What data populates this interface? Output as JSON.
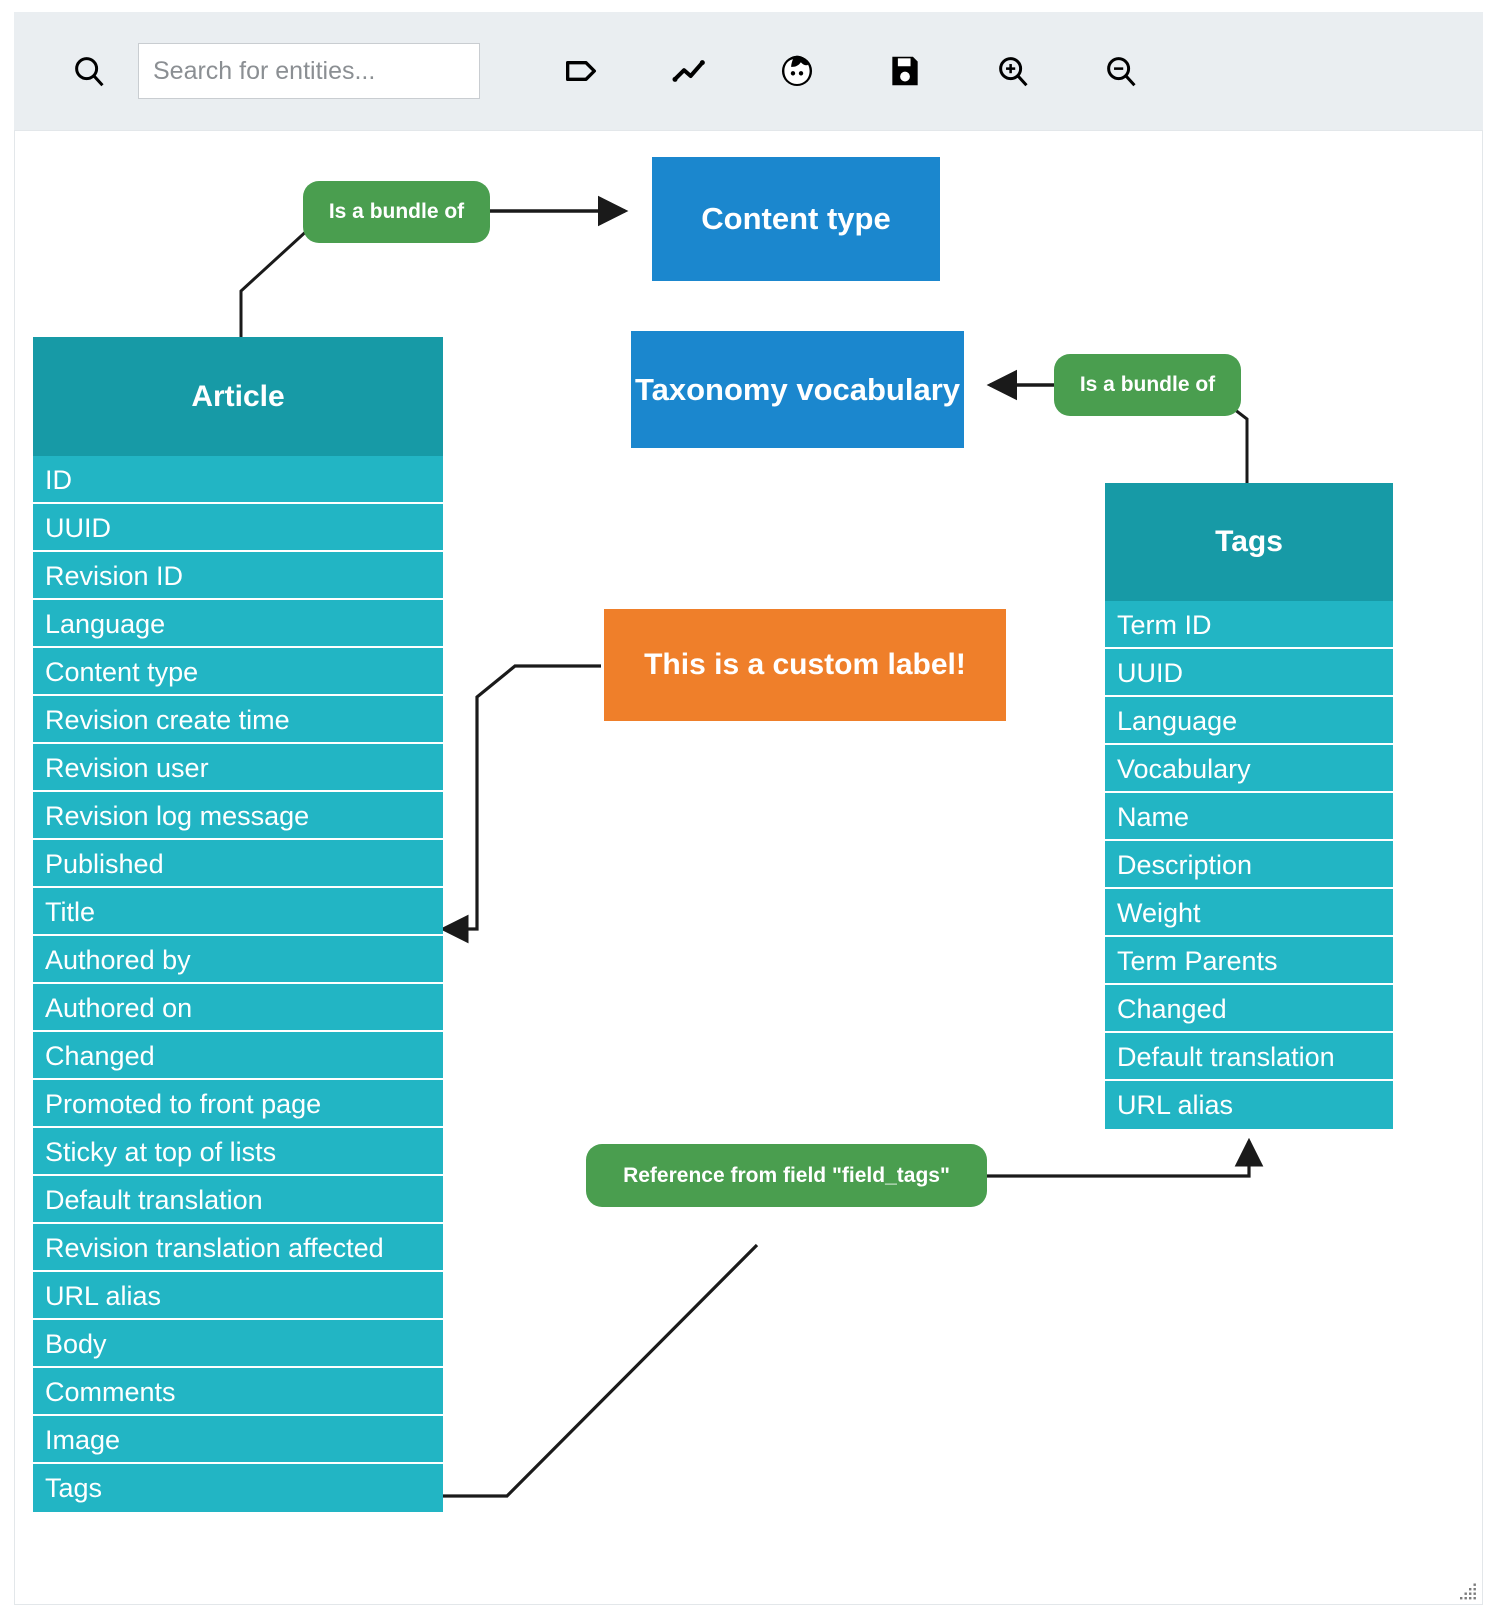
{
  "toolbar": {
    "search_icon": "search-icon",
    "search": {
      "value": "",
      "placeholder": "Search for entities..."
    },
    "buttons": [
      {
        "name": "tag-icon",
        "label": "Tag"
      },
      {
        "name": "line-chart-icon",
        "label": "Relations"
      },
      {
        "name": "person-icon",
        "label": "User"
      },
      {
        "name": "save-icon",
        "label": "Save"
      },
      {
        "name": "zoom-in-icon",
        "label": "Zoom in"
      },
      {
        "name": "zoom-out-icon",
        "label": "Zoom out"
      }
    ]
  },
  "colors": {
    "toolbar_bg": "#eaeef1",
    "entity_header": "#179aa6",
    "entity_row": "#22b5c4",
    "box_blue": "#1b87ce",
    "box_orange": "#ef7f2a",
    "pill_green": "#4a9e4f",
    "edge": "#1a1a1a",
    "canvas_bg": "#ffffff"
  },
  "diagram": {
    "entities": [
      {
        "id": "article",
        "title": "Article",
        "fields": [
          "ID",
          "UUID",
          "Revision ID",
          "Language",
          "Content type",
          "Revision create time",
          "Revision user",
          "Revision log message",
          "Published",
          "Title",
          "Authored by",
          "Authored on",
          "Changed",
          "Promoted to front page",
          "Sticky at top of lists",
          "Default translation",
          "Revision translation affected",
          "URL alias",
          "Body",
          "Comments",
          "Image",
          "Tags"
        ]
      },
      {
        "id": "tags",
        "title": "Tags",
        "fields": [
          "Term ID",
          "UUID",
          "Language",
          "Vocabulary",
          "Name",
          "Description",
          "Weight",
          "Term Parents",
          "Changed",
          "Default translation",
          "URL alias"
        ]
      }
    ],
    "boxes": [
      {
        "id": "content-type",
        "label": "Content type",
        "style": "blue"
      },
      {
        "id": "taxonomy-vocabulary",
        "label": "Taxonomy vocabulary",
        "style": "blue"
      },
      {
        "id": "custom-label",
        "label": "This is a custom label!",
        "style": "orange"
      }
    ],
    "relation_labels": [
      {
        "id": "bundle-of-content-type",
        "label": "Is a bundle of"
      },
      {
        "id": "bundle-of-taxonomy",
        "label": "Is a bundle of"
      },
      {
        "id": "field-tags-reference",
        "label": "Reference from field \"field_tags\""
      }
    ]
  }
}
